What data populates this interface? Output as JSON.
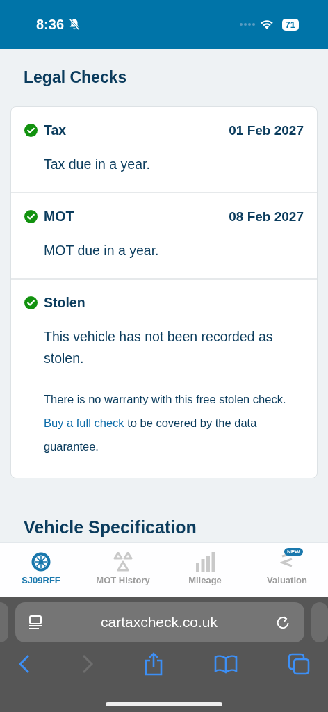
{
  "status_bar": {
    "time": "8:36",
    "battery": "71"
  },
  "legal_checks": {
    "title": "Legal Checks",
    "checks": [
      {
        "name": "Tax",
        "passed": true,
        "date": "01 Feb 2027",
        "description": "Tax due in a year."
      },
      {
        "name": "MOT",
        "passed": true,
        "date": "08 Feb 2027",
        "description": "MOT due in a year."
      },
      {
        "name": "Stolen",
        "passed": true,
        "description": "This vehicle has not been recorded as stolen.",
        "note": {
          "before": "There is no warranty with this free stolen check.",
          "link": "Buy a full check",
          "after": "to be covered by the data guarantee."
        }
      }
    ]
  },
  "vehicle_specification": {
    "title": "Vehicle Specification"
  },
  "bottom_nav": [
    {
      "label": "SJ09RFF",
      "kind": "wheel",
      "selected": true
    },
    {
      "label": "MOT History",
      "kind": "mot",
      "selected": false
    },
    {
      "label": "Mileage",
      "kind": "bars",
      "selected": false
    },
    {
      "label": "Valuation",
      "kind": "valuation",
      "selected": false,
      "badge": "NEW"
    }
  ],
  "browser": {
    "url": "cartaxcheck.co.uk"
  }
}
